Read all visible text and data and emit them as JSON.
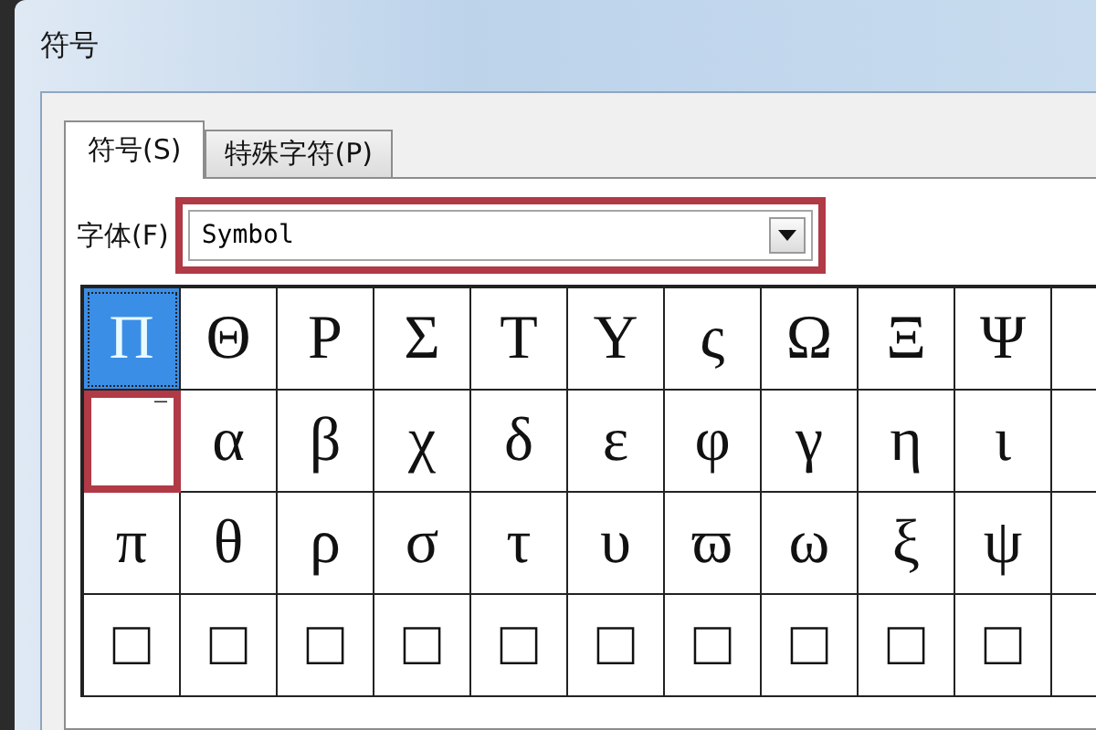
{
  "window": {
    "title": "符号"
  },
  "tabs": [
    {
      "label": "符号(S)",
      "selected": true
    },
    {
      "label": "特殊字符(P)",
      "selected": false
    }
  ],
  "font": {
    "label": "字体(F)",
    "value": "Symbol",
    "annotated": true
  },
  "grid": [
    [
      {
        "glyph": "Π",
        "selected": true,
        "annotated": false
      },
      {
        "glyph": "Θ",
        "selected": false,
        "annotated": false
      },
      {
        "glyph": "Ρ",
        "selected": false,
        "annotated": false
      },
      {
        "glyph": "Σ",
        "selected": false,
        "annotated": false
      },
      {
        "glyph": "Τ",
        "selected": false,
        "annotated": false
      },
      {
        "glyph": "Υ",
        "selected": false,
        "annotated": false
      },
      {
        "glyph": "ς",
        "selected": false,
        "annotated": false
      },
      {
        "glyph": "Ω",
        "selected": false,
        "annotated": false
      },
      {
        "glyph": "Ξ",
        "selected": false,
        "annotated": false
      },
      {
        "glyph": "Ψ",
        "selected": false,
        "annotated": false
      }
    ],
    [
      {
        "glyph": "‾",
        "selected": false,
        "annotated": true
      },
      {
        "glyph": "α",
        "selected": false,
        "annotated": false
      },
      {
        "glyph": "β",
        "selected": false,
        "annotated": false
      },
      {
        "glyph": "χ",
        "selected": false,
        "annotated": false
      },
      {
        "glyph": "δ",
        "selected": false,
        "annotated": false
      },
      {
        "glyph": "ε",
        "selected": false,
        "annotated": false
      },
      {
        "glyph": "φ",
        "selected": false,
        "annotated": false
      },
      {
        "glyph": "γ",
        "selected": false,
        "annotated": false
      },
      {
        "glyph": "η",
        "selected": false,
        "annotated": false
      },
      {
        "glyph": "ι",
        "selected": false,
        "annotated": false
      }
    ],
    [
      {
        "glyph": "π",
        "selected": false,
        "annotated": false
      },
      {
        "glyph": "θ",
        "selected": false,
        "annotated": false
      },
      {
        "glyph": "ρ",
        "selected": false,
        "annotated": false
      },
      {
        "glyph": "σ",
        "selected": false,
        "annotated": false
      },
      {
        "glyph": "τ",
        "selected": false,
        "annotated": false
      },
      {
        "glyph": "υ",
        "selected": false,
        "annotated": false
      },
      {
        "glyph": "ϖ",
        "selected": false,
        "annotated": false
      },
      {
        "glyph": "ω",
        "selected": false,
        "annotated": false
      },
      {
        "glyph": "ξ",
        "selected": false,
        "annotated": false
      },
      {
        "glyph": "ψ",
        "selected": false,
        "annotated": false
      }
    ],
    [
      {
        "glyph": "□",
        "selected": false,
        "annotated": false
      },
      {
        "glyph": "□",
        "selected": false,
        "annotated": false
      },
      {
        "glyph": "□",
        "selected": false,
        "annotated": false
      },
      {
        "glyph": "□",
        "selected": false,
        "annotated": false
      },
      {
        "glyph": "□",
        "selected": false,
        "annotated": false
      },
      {
        "glyph": "□",
        "selected": false,
        "annotated": false
      },
      {
        "glyph": "□",
        "selected": false,
        "annotated": false
      },
      {
        "glyph": "□",
        "selected": false,
        "annotated": false
      },
      {
        "glyph": "□",
        "selected": false,
        "annotated": false
      },
      {
        "glyph": "□",
        "selected": false,
        "annotated": false
      }
    ]
  ]
}
